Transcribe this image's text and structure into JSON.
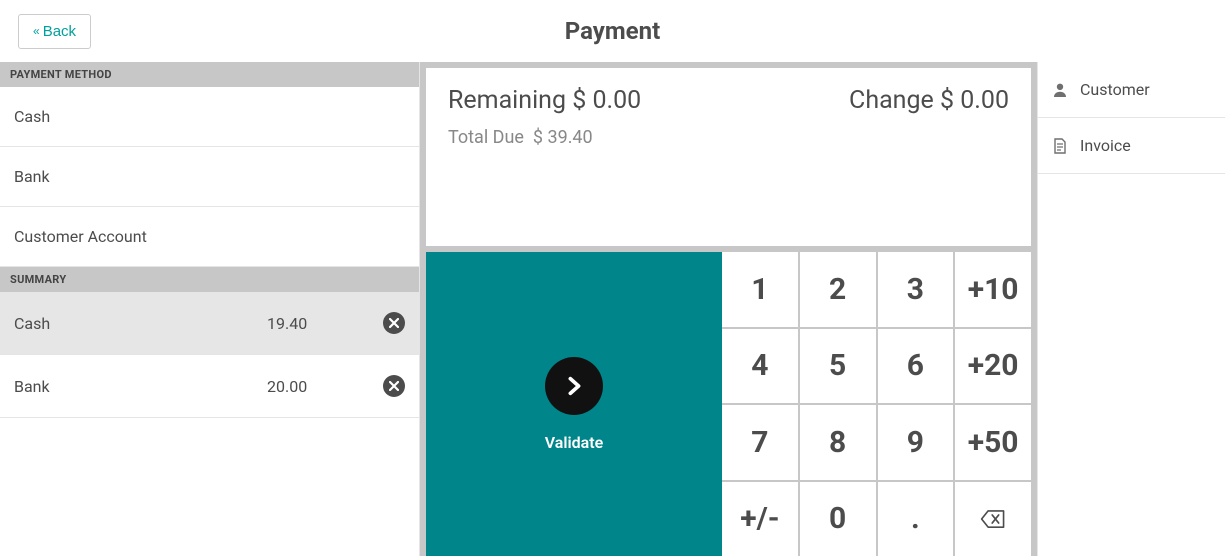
{
  "header": {
    "back_label": "Back",
    "title": "Payment"
  },
  "left": {
    "payment_method_header": "PAYMENT METHOD",
    "methods": [
      "Cash",
      "Bank",
      "Customer Account"
    ],
    "summary_header": "SUMMARY",
    "summary": [
      {
        "name": "Cash",
        "amount": "19.40",
        "selected": true
      },
      {
        "name": "Bank",
        "amount": "20.00",
        "selected": false
      }
    ]
  },
  "center": {
    "remaining_label": "Remaining",
    "remaining_value": "$ 0.00",
    "change_label": "Change",
    "change_value": "$ 0.00",
    "total_due_label": "Total Due",
    "total_due_value": "$ 39.40",
    "validate_label": "Validate",
    "keys": [
      "1",
      "2",
      "3",
      "+10",
      "4",
      "5",
      "6",
      "+20",
      "7",
      "8",
      "9",
      "+50",
      "+/-",
      "0",
      ".",
      "⌫"
    ]
  },
  "right": {
    "customer_label": "Customer",
    "invoice_label": "Invoice"
  }
}
